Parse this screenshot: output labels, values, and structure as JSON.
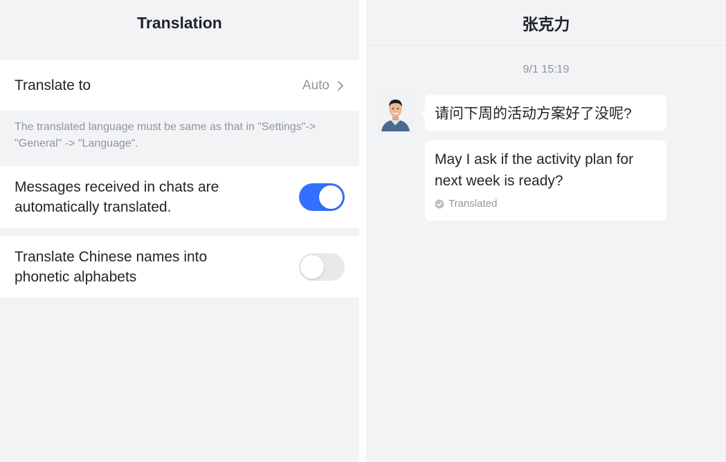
{
  "left": {
    "title": "Translation",
    "translate_to": {
      "label": "Translate to",
      "value": "Auto"
    },
    "hint": "The translated language must be same as that in \"Settings\"-> \"General\" -> \"Language\".",
    "auto_translate": {
      "label": "Messages received in chats are automatically translated.",
      "enabled": true
    },
    "phonetic": {
      "label": "Translate Chinese names into phonetic alphabets",
      "enabled": false
    }
  },
  "chat": {
    "title": "张克力",
    "timestamp": "9/1 15:19",
    "messages": [
      {
        "original": "请问下周的活动方案好了没呢?",
        "translation": "May I ask if the activity plan for next week is ready?",
        "translated_tag": "Translated"
      }
    ]
  },
  "colors": {
    "accent": "#3370ff",
    "background": "#f2f3f5",
    "secondary_text": "#8f959e"
  },
  "icons": [
    "chevron-right-icon",
    "check-circle-icon",
    "avatar"
  ]
}
